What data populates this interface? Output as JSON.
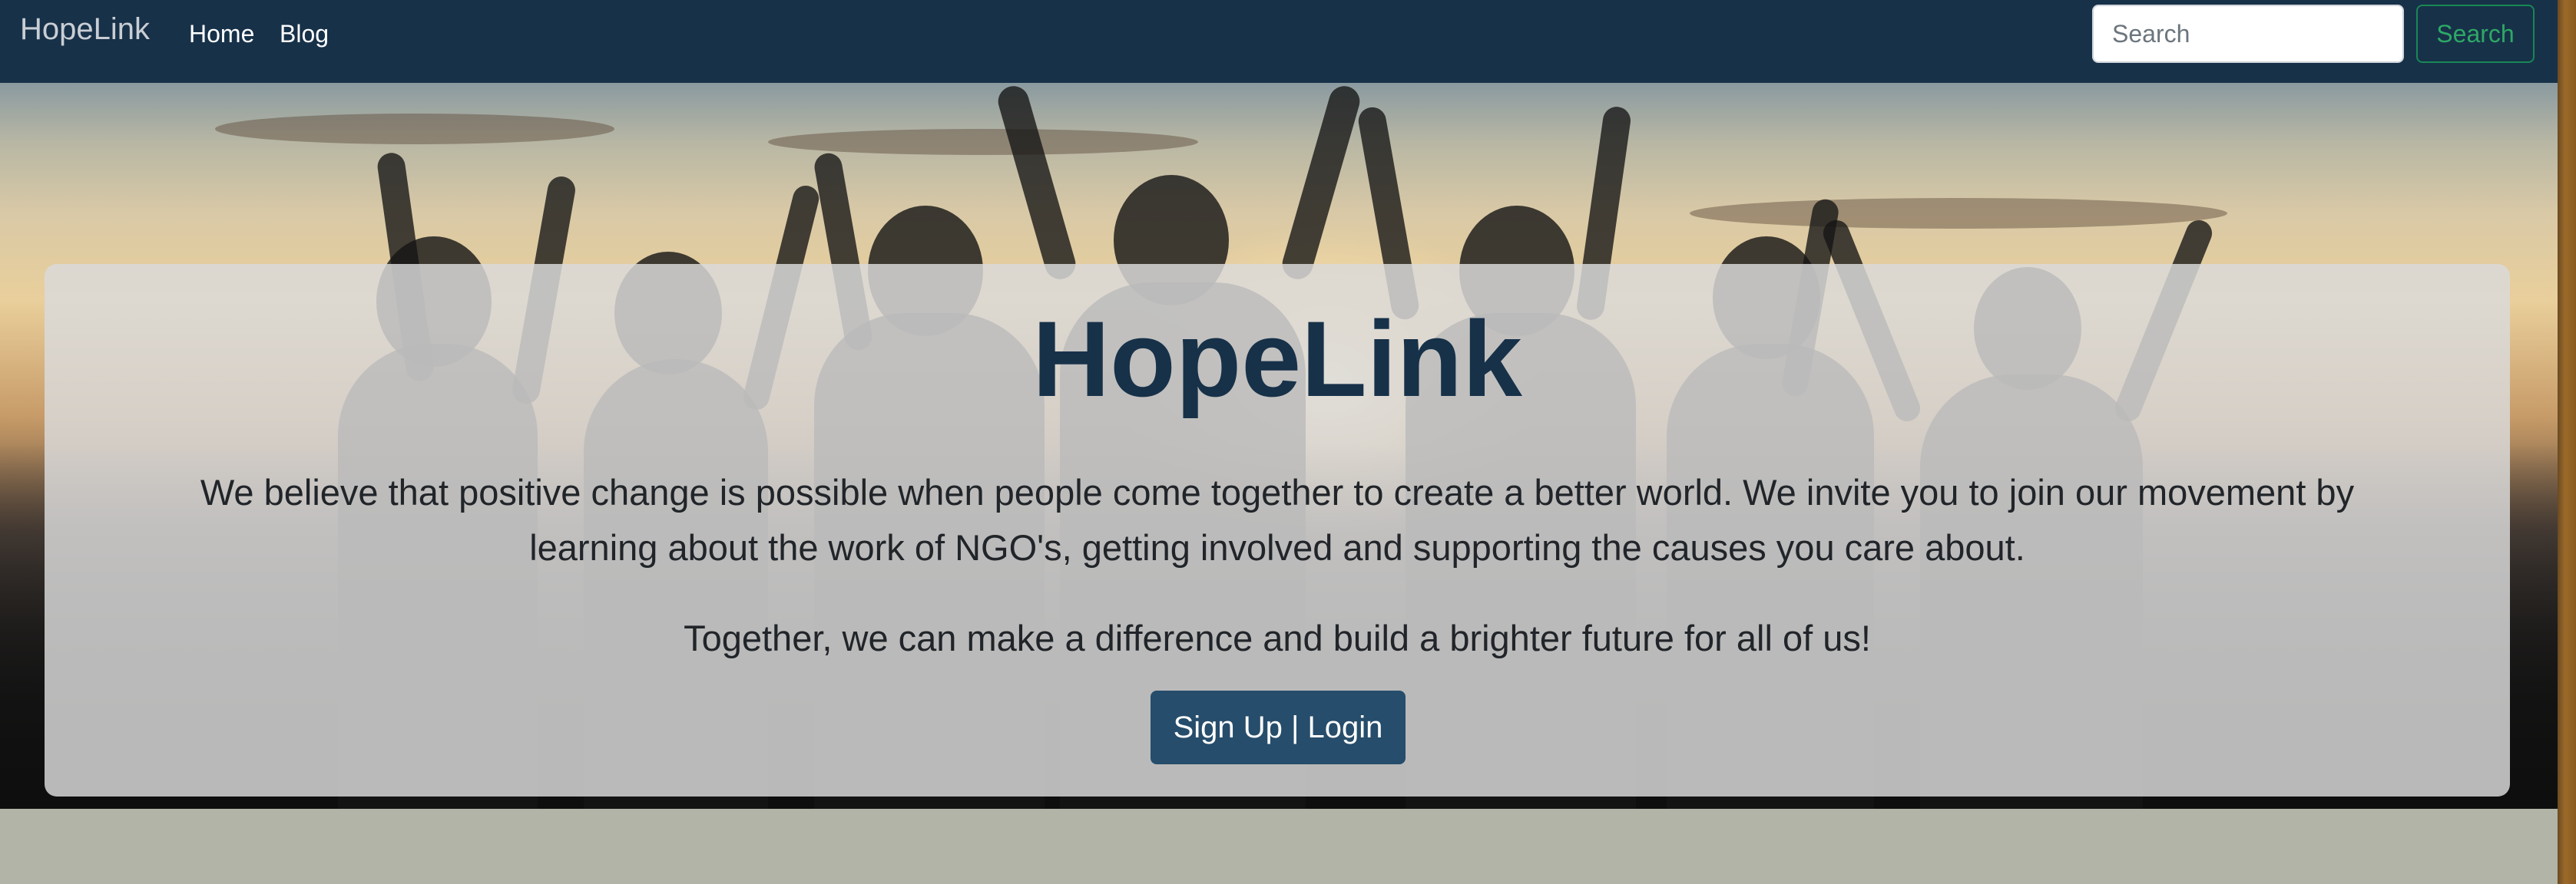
{
  "navbar": {
    "brand": "HopeLink",
    "links": [
      {
        "label": "Home"
      },
      {
        "label": "Blog"
      }
    ],
    "search": {
      "placeholder": "Search",
      "value": "",
      "button_label": "Search"
    }
  },
  "hero": {
    "title": "HopeLink",
    "paragraph": "We believe that positive change is possible when people come together to create a better world. We invite you to join our movement by learning about the work of NGO's, getting involved and supporting the causes you care about.",
    "tagline": "Together, we can make a difference and build a brighter future for all of us!",
    "cta_label": "Sign Up | Login"
  },
  "colors": {
    "navbar_bg": "#173149",
    "title": "#173149",
    "cta_bg": "#264d6b",
    "search_accent": "#198754",
    "page_bg": "#b1b4a6"
  }
}
